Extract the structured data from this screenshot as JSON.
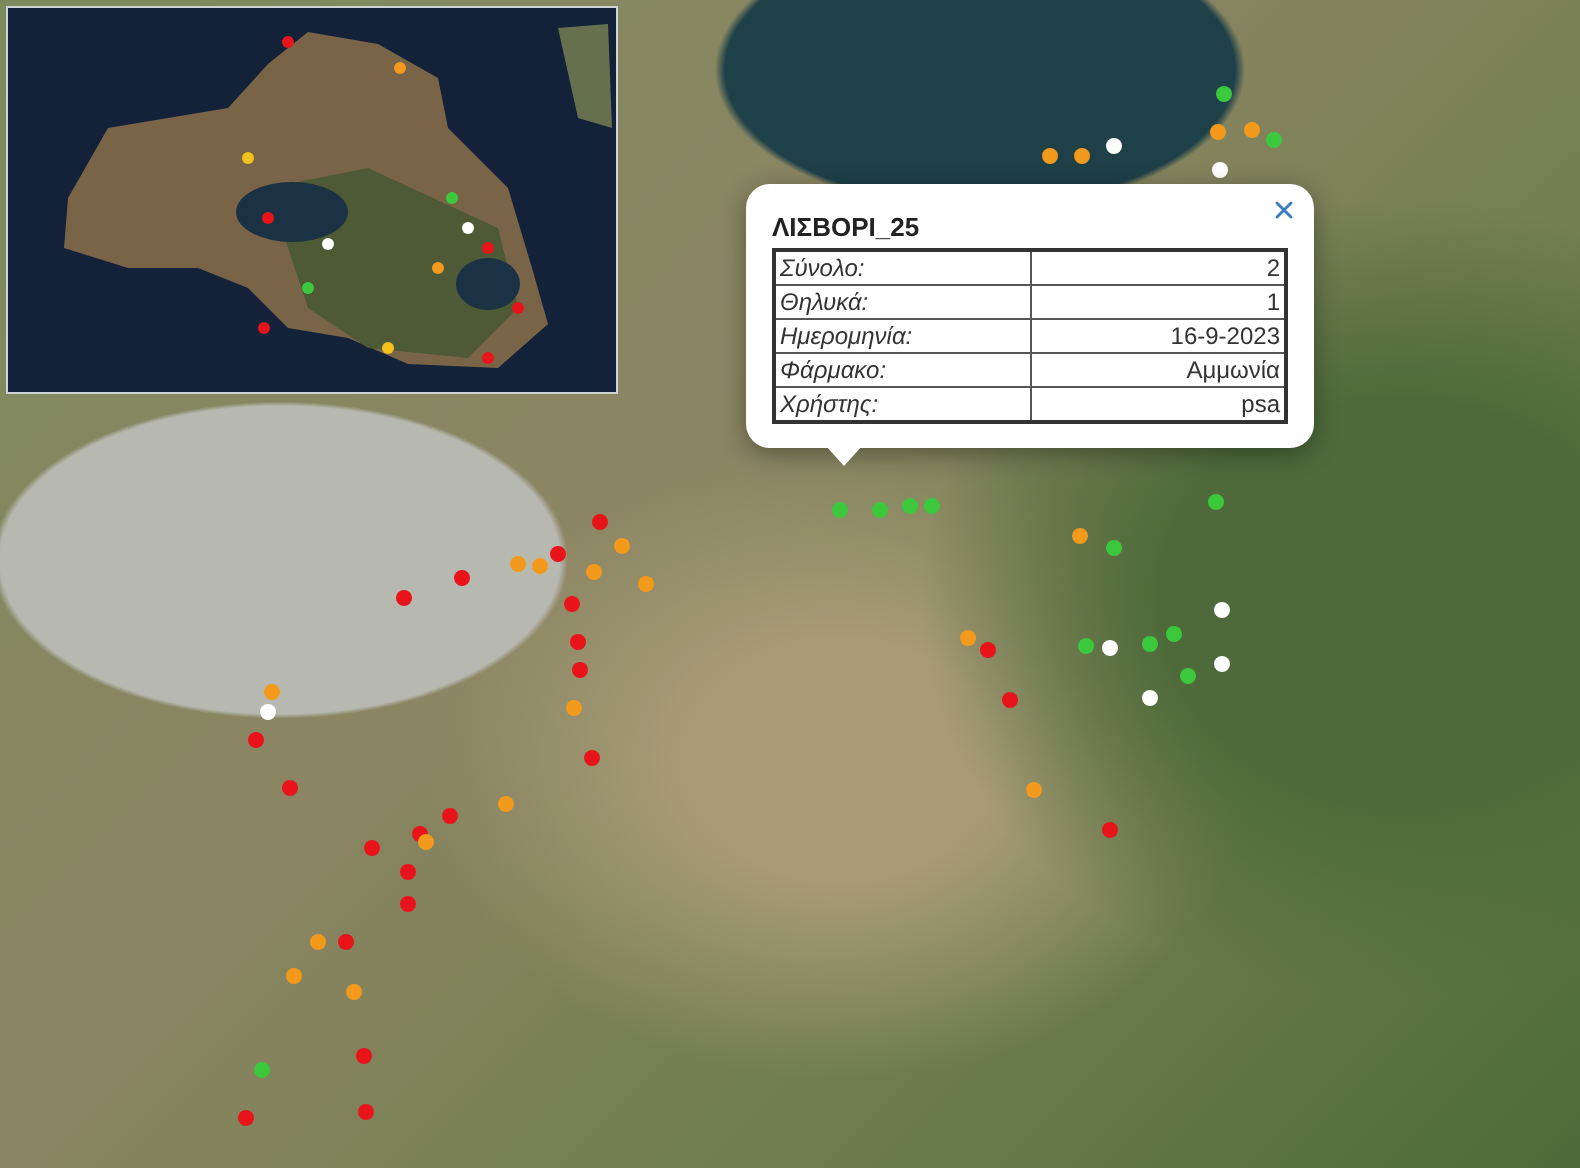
{
  "popup": {
    "title": "ΛΙΣΒΟΡΙ_25",
    "rows": [
      {
        "label": "Σύνολο:",
        "value": "2"
      },
      {
        "label": "Θηλυκά:",
        "value": "1"
      },
      {
        "label": "Ημερομηνία:",
        "value": "16-9-2023"
      },
      {
        "label": "Φάρμακο:",
        "value": "Αμμωνία"
      },
      {
        "label": "Χρήστης:",
        "value": "psa"
      }
    ]
  },
  "markers": [
    {
      "color": "#3cc83c"
    },
    {
      "color": "#f39a1c"
    },
    {
      "color": "#f39a1c"
    },
    {
      "color": "#ffffff"
    },
    {
      "color": "#f39a1c"
    },
    {
      "color": "#f39a1c"
    },
    {
      "color": "#3cc83c"
    },
    {
      "color": "#ffffff"
    },
    {
      "color": "#3cc83c"
    },
    {
      "color": "#3cc83c"
    },
    {
      "color": "#3cc83c"
    },
    {
      "color": "#3cc83c"
    },
    {
      "color": "#3cc83c"
    },
    {
      "color": "#f39a1c"
    },
    {
      "color": "#3cc83c"
    },
    {
      "color": "#f39a1c"
    },
    {
      "color": "#e8141a"
    },
    {
      "color": "#e8141a"
    },
    {
      "color": "#3cc83c"
    },
    {
      "color": "#ffffff"
    },
    {
      "color": "#3cc83c"
    },
    {
      "color": "#3cc83c"
    },
    {
      "color": "#ffffff"
    },
    {
      "color": "#ffffff"
    },
    {
      "color": "#3cc83c"
    },
    {
      "color": "#ffffff"
    },
    {
      "color": "#f39a1c"
    },
    {
      "color": "#e8141a"
    },
    {
      "color": "#e8141a"
    },
    {
      "color": "#e8141a"
    },
    {
      "color": "#f39a1c"
    },
    {
      "color": "#f39a1c"
    },
    {
      "color": "#f39a1c"
    },
    {
      "color": "#f39a1c"
    },
    {
      "color": "#f39a1c"
    },
    {
      "color": "#e8141a"
    },
    {
      "color": "#e8141a"
    },
    {
      "color": "#e8141a"
    },
    {
      "color": "#e8141a"
    },
    {
      "color": "#e8141a"
    },
    {
      "color": "#f39a1c"
    },
    {
      "color": "#e8141a"
    },
    {
      "color": "#f39a1c"
    },
    {
      "color": "#ffffff"
    },
    {
      "color": "#e8141a"
    },
    {
      "color": "#e8141a"
    },
    {
      "color": "#f39a1c"
    },
    {
      "color": "#e8141a"
    },
    {
      "color": "#e8141a"
    },
    {
      "color": "#f39a1c"
    },
    {
      "color": "#e8141a"
    },
    {
      "color": "#e8141a"
    },
    {
      "color": "#e8141a"
    },
    {
      "color": "#f39a1c"
    },
    {
      "color": "#e8141a"
    },
    {
      "color": "#f39a1c"
    },
    {
      "color": "#f39a1c"
    },
    {
      "color": "#e8141a"
    },
    {
      "color": "#3cc83c"
    },
    {
      "color": "#e8141a"
    },
    {
      "color": "#e8141a"
    }
  ]
}
